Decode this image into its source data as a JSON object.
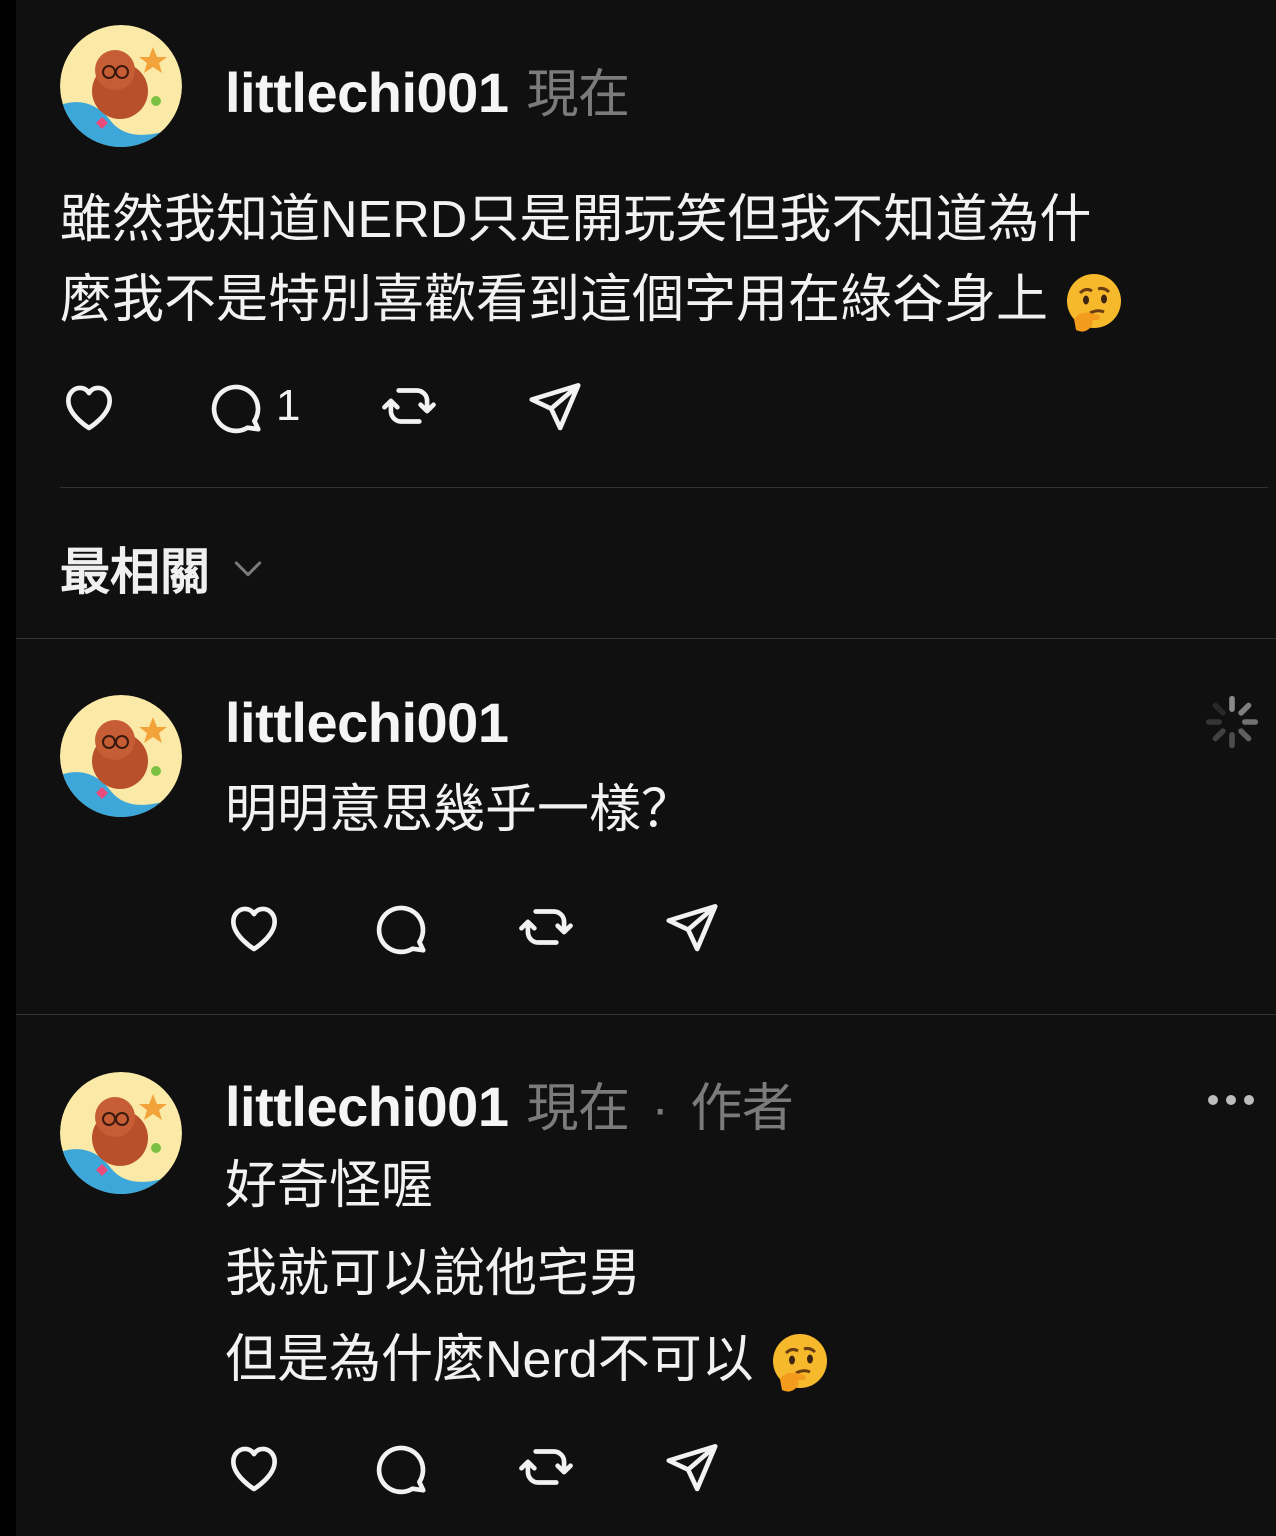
{
  "post": {
    "username": "littlechi001",
    "time": "現在",
    "text_line1": "雖然我知道NERD只是開玩笑但我不知道為什",
    "text_line2": "麼我不是特別喜歡看到這個字用在綠谷身上",
    "emoji": "thinking-face",
    "reply_count": "1"
  },
  "sort": {
    "label": "最相關"
  },
  "replies": [
    {
      "username": "littlechi001",
      "line1": "明明意思幾乎一樣？",
      "status_icon": "loading-spinner-icon"
    },
    {
      "username": "littlechi001",
      "time": "現在",
      "role": "作者",
      "separator": "·",
      "line1": "好奇怪喔",
      "line2": "我就可以說他宅男",
      "line3": "但是為什麼Nerd不可以",
      "emoji": "thinking-face",
      "menu_icon": "more-icon"
    }
  ],
  "colors": {
    "background": "#101010",
    "text": "#f2f2f2",
    "muted": "#7b7b7b",
    "divider": "#333333"
  }
}
